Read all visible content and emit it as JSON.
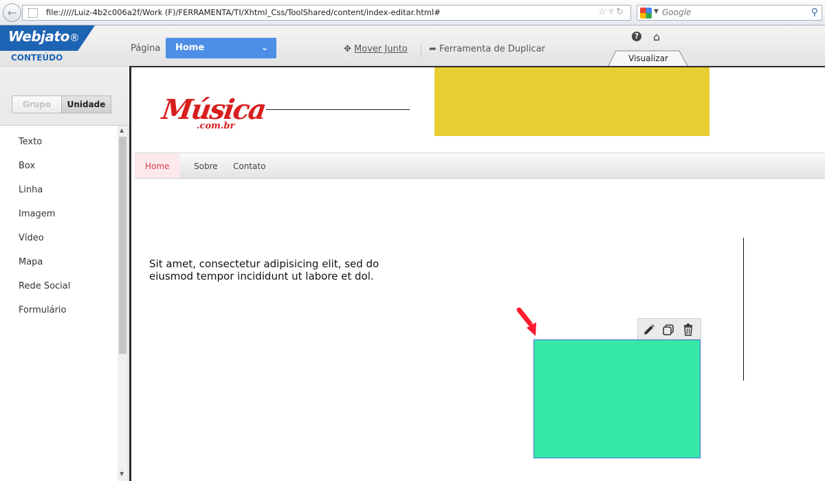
{
  "browser": {
    "url": "file://///Luiz-4b2c006a2f/Work  (F)/FERRAMENTA/TI/Xhtml_Css/ToolShared/content/index-editar.html#",
    "search_placeholder": "Google"
  },
  "app": {
    "logo": "Webjato",
    "logo_mark": "®",
    "section": "CONTEÚDO"
  },
  "header": {
    "page_label": "Página",
    "page_selected": "Home",
    "mover_label": "Mover Junto",
    "duplicate_label": "Ferramenta de Duplicar",
    "view_tab": "Visualizar"
  },
  "sidebar": {
    "segments": [
      {
        "label": "Grupo",
        "active": false
      },
      {
        "label": "Unidade",
        "active": true
      }
    ],
    "tools": [
      "Texto",
      "Box",
      "Linha",
      "Imagem",
      "Vídeo",
      "Mapa",
      "Rede Social",
      "Formulário"
    ]
  },
  "site": {
    "logo_main": "Música",
    "logo_sub": ".com.br",
    "nav": [
      {
        "label": "Home",
        "active": true
      },
      {
        "label": "Sobre",
        "active": false
      },
      {
        "label": "Contato",
        "active": false
      }
    ],
    "text_line_1": "Sit amet, consectetur adipisicing elit, sed do",
    "text_line_2": "eiusmod tempor incididunt ut  labore et dol."
  },
  "colors": {
    "brand_blue": "#1e64b4",
    "select_blue": "#4d8ee6",
    "yellow_box": "#e8cd33",
    "green_box": "#36e8a5",
    "logo_red": "#d81e1e",
    "arrow_red": "#ff1a2e"
  },
  "icons": {
    "toolbar": [
      "pencil-icon",
      "duplicate-icon",
      "trash-icon"
    ]
  }
}
